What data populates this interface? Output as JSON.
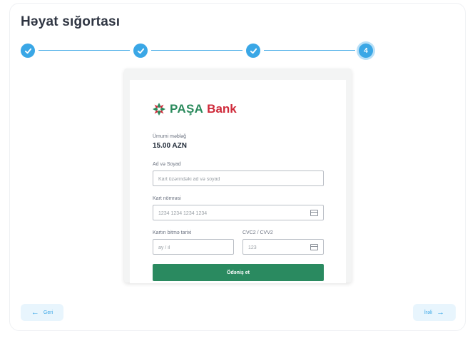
{
  "page": {
    "title": "Həyat sığortası"
  },
  "stepper": {
    "current_step": "4",
    "total_steps": 4,
    "completed_steps": 3,
    "accent_color": "#3aa7e6"
  },
  "payment": {
    "bank": {
      "name_part1": "PAŞA",
      "name_part2": "Bank",
      "brand_green": "#2a8a5c",
      "brand_red": "#cf2a3a"
    },
    "amount_label": "Ümumi məbləğ",
    "amount_value": "15.00 AZN",
    "name_label": "Ad və Soyad",
    "name_placeholder": "Kart üzərindəki ad və soyad",
    "card_label": "Kart nömrəsi",
    "card_placeholder": "1234 1234 1234 1234",
    "expiry_label": "Kartın bitmə tarixi",
    "expiry_placeholder": "ay / il",
    "cvc_label": "CVC2 / CVV2",
    "cvc_placeholder": "123",
    "pay_button": "Ödəniş et",
    "pay_button_color": "#2a8a60"
  },
  "nav": {
    "back_label": "Geri",
    "next_label": "İrəli"
  }
}
